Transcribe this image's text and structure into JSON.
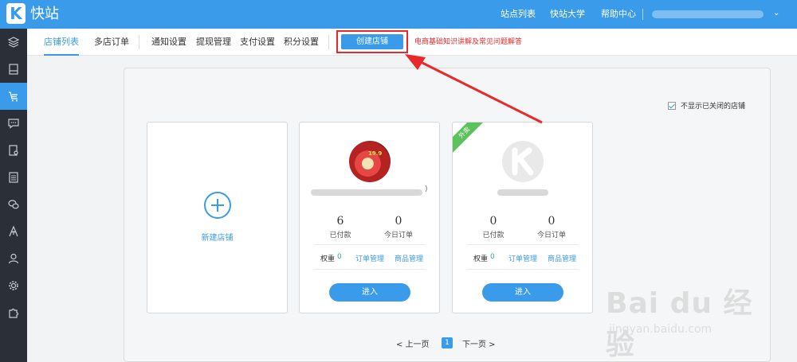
{
  "header": {
    "logo_letter": "K",
    "brand": "快站",
    "nav": [
      "站点列表",
      "快站大学",
      "帮助中心"
    ]
  },
  "tabs": [
    {
      "label": "店铺列表",
      "active": true
    },
    {
      "label": "多店订单"
    },
    {
      "label": "通知设置"
    },
    {
      "label": "提现管理"
    },
    {
      "label": "支付设置"
    },
    {
      "label": "积分设置"
    }
  ],
  "toolbar": {
    "create_label": "创建店铺",
    "help_link": "电商基础知识讲解及常见问题解答"
  },
  "options": {
    "hide_closed_label": "不显示已关闭的店铺",
    "hide_closed_checked": true
  },
  "new_card": {
    "label": "新建店铺"
  },
  "shops": [
    {
      "avatar_text": "19.9",
      "name_suffix": ")",
      "paid_count": "6",
      "paid_label": "已付款",
      "today_orders": "0",
      "today_label": "今日订单",
      "weight_label": "权重",
      "weight_value": "0",
      "orders_link": "订单管理",
      "products_link": "商品管理",
      "enter_label": "进入"
    },
    {
      "ribbon": "外卖",
      "avatar_text": "K",
      "paid_count": "0",
      "paid_label": "已付款",
      "today_orders": "0",
      "today_label": "今日订单",
      "weight_label": "权重",
      "weight_value": "0",
      "orders_link": "订单管理",
      "products_link": "商品管理",
      "enter_label": "进入"
    }
  ],
  "pagination": {
    "prev": "< 上一页",
    "current": "1",
    "next": "下一页 >"
  },
  "watermark": {
    "main": "Bai du 经验",
    "sub": "jingyan.baidu.com"
  },
  "colors": {
    "primary": "#3a9bea",
    "sidebar": "#2b2f38",
    "highlight": "#e8282b",
    "ribbon": "#5cc25c"
  }
}
